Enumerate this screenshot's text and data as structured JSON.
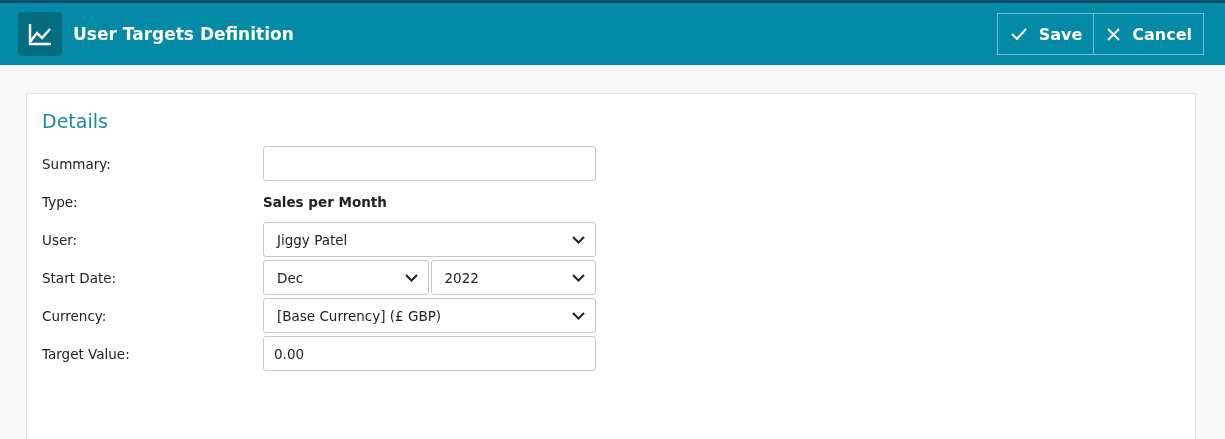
{
  "header": {
    "title": "User Targets Definition",
    "buttons": [
      {
        "kind": "save",
        "label": "Save"
      },
      {
        "kind": "cancel",
        "label": "Cancel"
      }
    ]
  },
  "details": {
    "heading": "Details",
    "fields": [
      {
        "kind": "input",
        "label": "Summary:"
      },
      {
        "kind": "text",
        "label": "Type:",
        "value": "Sales per Month"
      },
      {
        "kind": "select",
        "label": "User:",
        "value": "Jiggy Patel"
      },
      {
        "kind": "select-pair",
        "label": "Start Date:",
        "values": [
          "Dec",
          "2022"
        ]
      },
      {
        "kind": "select",
        "label": "Currency:",
        "value": "[Base Currency] (£ GBP)"
      },
      {
        "kind": "input",
        "label": "Target Value:",
        "value": "0.00"
      }
    ]
  }
}
